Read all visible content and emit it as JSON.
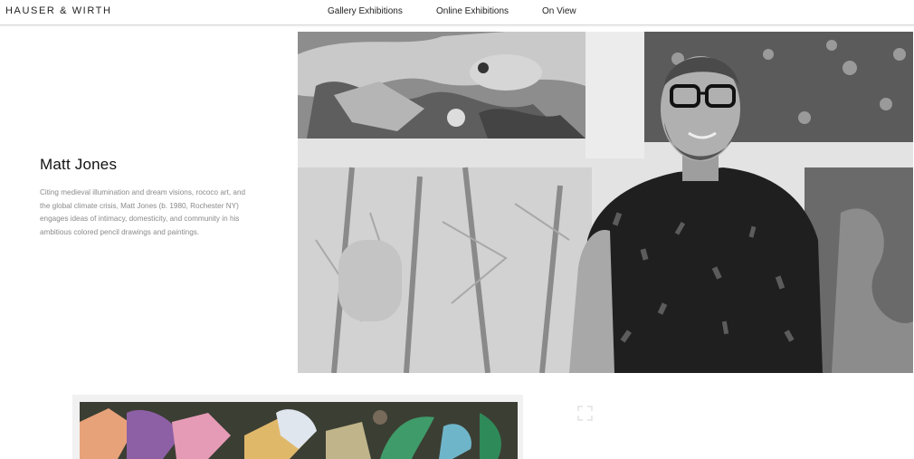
{
  "brand": {
    "logo": "HAUSER & WIRTH"
  },
  "nav": {
    "items": [
      {
        "label": "Gallery Exhibitions"
      },
      {
        "label": "Online Exhibitions"
      },
      {
        "label": "On View"
      }
    ]
  },
  "intro": {
    "title": "Matt Jones",
    "description": "Citing medieval illumination and dream visions, rococo art, and the global climate crisis, Matt Jones (b. 1980, Rochester NY) engages ideas of intimacy, domesticity, and community in his ambitious colored pencil drawings and paintings."
  },
  "icons": {
    "expand": "expand-icon"
  }
}
